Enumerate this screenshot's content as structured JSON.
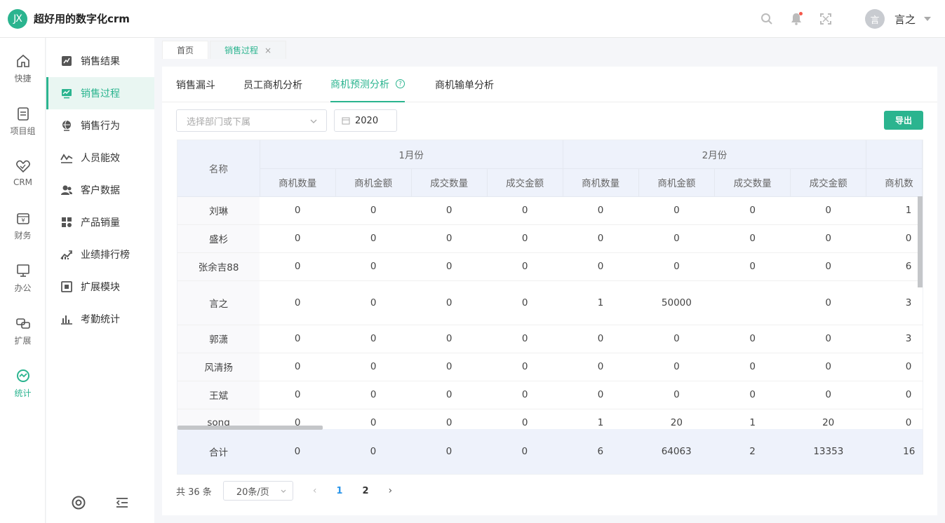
{
  "app": {
    "logo_text": "JX",
    "title": "超好用的数字化crm"
  },
  "header": {
    "avatar_text": "言",
    "username": "言之"
  },
  "rail": [
    {
      "label": "快捷",
      "icon": "home-icon"
    },
    {
      "label": "项目组",
      "icon": "document-icon"
    },
    {
      "label": "CRM",
      "icon": "heart-icon"
    },
    {
      "label": "财务",
      "icon": "yen-icon"
    },
    {
      "label": "办公",
      "icon": "monitor-icon"
    },
    {
      "label": "扩展",
      "icon": "link-icon"
    },
    {
      "label": "统计",
      "icon": "chart-circle-icon",
      "active": true
    }
  ],
  "sidebar": {
    "items": [
      {
        "label": "销售结果",
        "icon": "chart-result-icon"
      },
      {
        "label": "销售过程",
        "icon": "screen-chart-icon",
        "active": true
      },
      {
        "label": "销售行为",
        "icon": "globe-icon"
      },
      {
        "label": "人员能效",
        "icon": "line-chart-icon"
      },
      {
        "label": "客户数据",
        "icon": "users-icon"
      },
      {
        "label": "产品销量",
        "icon": "grid-icon"
      },
      {
        "label": "业绩排行榜",
        "icon": "ranking-icon"
      },
      {
        "label": "扩展模块",
        "icon": "module-icon"
      },
      {
        "label": "考勤统计",
        "icon": "attendance-icon"
      }
    ]
  },
  "page_tabs": [
    {
      "label": "首页"
    },
    {
      "label": "销售过程",
      "active": true,
      "close": "×"
    }
  ],
  "analysis_tabs": [
    {
      "label": "销售漏斗"
    },
    {
      "label": "员工商机分析"
    },
    {
      "label": "商机预测分析",
      "active": true,
      "help": "?"
    },
    {
      "label": "商机输单分析"
    }
  ],
  "filters": {
    "dept_placeholder": "选择部门或下属",
    "year": "2020",
    "export_label": "导出"
  },
  "table": {
    "name_header": "名称",
    "months": [
      "1月份",
      "2月份"
    ],
    "sub_headers": [
      "商机数量",
      "商机金额",
      "成交数量",
      "成交金额"
    ],
    "extra_header": "商机数",
    "rows": [
      {
        "name": "刘琳",
        "values": [
          "0",
          "0",
          "0",
          "0",
          "0",
          "0",
          "0",
          "0",
          "1"
        ]
      },
      {
        "name": "盛杉",
        "values": [
          "0",
          "0",
          "0",
          "0",
          "0",
          "0",
          "0",
          "0",
          "0"
        ]
      },
      {
        "name": "张余吉88",
        "values": [
          "0",
          "0",
          "0",
          "0",
          "0",
          "0",
          "0",
          "0",
          "6"
        ]
      },
      {
        "name": "言之",
        "values": [
          "0",
          "0",
          "0",
          "0",
          "1",
          "50000",
          "",
          "0",
          "3"
        ],
        "tall": true
      },
      {
        "name": "郭潇",
        "values": [
          "0",
          "0",
          "0",
          "0",
          "0",
          "0",
          "0",
          "0",
          "3"
        ]
      },
      {
        "name": "风清扬",
        "values": [
          "0",
          "0",
          "0",
          "0",
          "0",
          "0",
          "0",
          "0",
          "0"
        ]
      },
      {
        "name": "王斌",
        "values": [
          "0",
          "0",
          "0",
          "0",
          "0",
          "0",
          "0",
          "0",
          "0"
        ]
      },
      {
        "name": "song",
        "values": [
          "0",
          "0",
          "0",
          "0",
          "1",
          "20",
          "1",
          "20",
          "0"
        ]
      }
    ],
    "summary": {
      "name": "合计",
      "values": [
        "0",
        "0",
        "0",
        "0",
        "6",
        "64063",
        "2",
        "13353",
        "16"
      ]
    }
  },
  "pagination": {
    "total_text": "共 36 条",
    "page_size": "20条/页",
    "prev": "‹",
    "next": "›",
    "pages": [
      "1",
      "2"
    ],
    "current": "1"
  },
  "colors": {
    "accent": "#2bb48f",
    "header_bg": "#eef2fb",
    "page_active": "#2b95e9"
  }
}
